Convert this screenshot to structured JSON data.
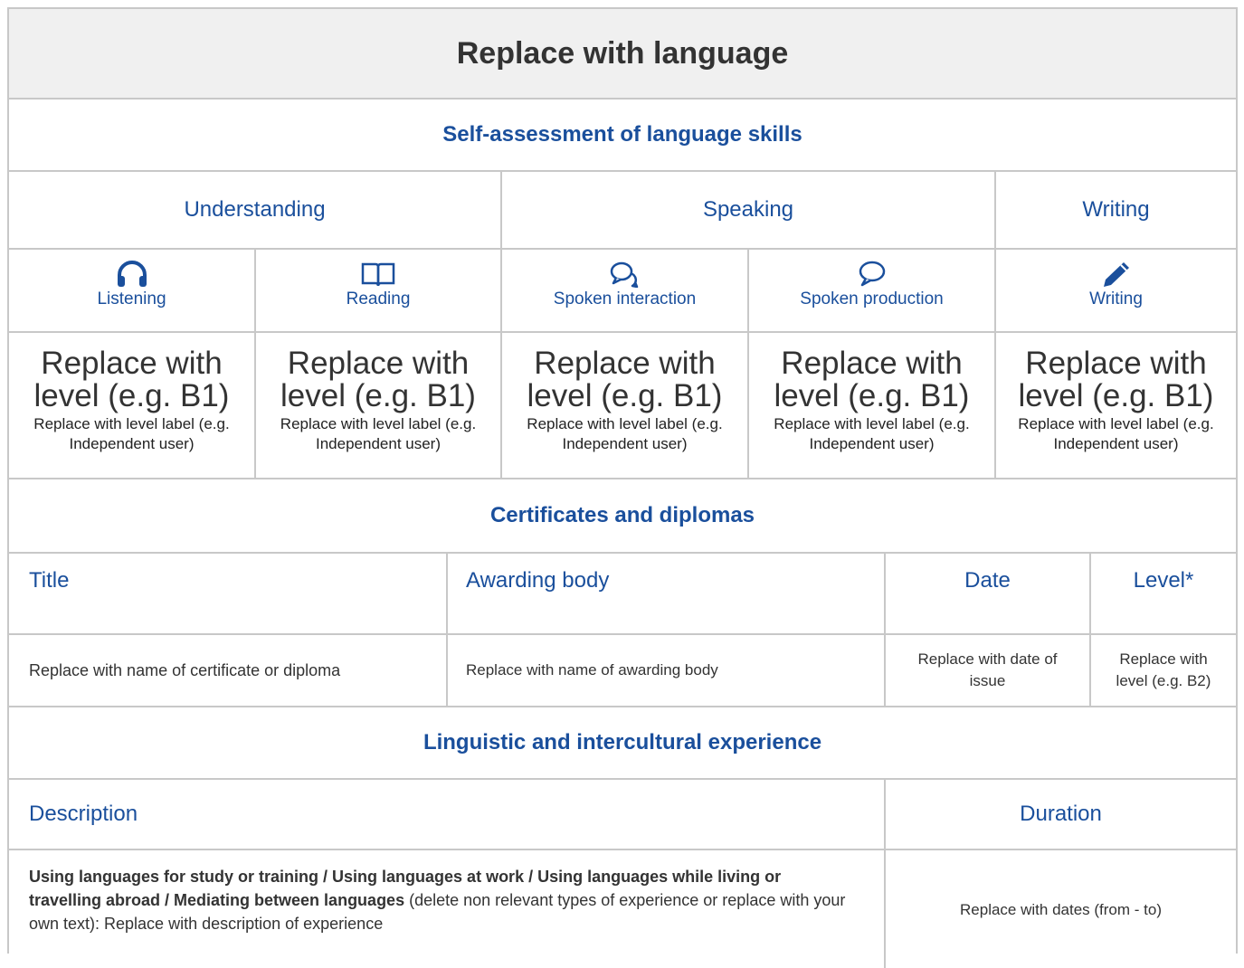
{
  "header": {
    "title": "Replace with language"
  },
  "self_assessment": {
    "heading": "Self-assessment of language skills",
    "groups": {
      "understanding": "Understanding",
      "speaking": "Speaking",
      "writing": "Writing"
    },
    "skills": [
      {
        "label": "Listening",
        "icon": "headphones-icon"
      },
      {
        "label": "Reading",
        "icon": "book-icon"
      },
      {
        "label": "Spoken interaction",
        "icon": "chat-bubbles-icon"
      },
      {
        "label": "Spoken production",
        "icon": "speech-bubble-icon"
      },
      {
        "label": "Writing",
        "icon": "pencil-icon"
      }
    ],
    "levels": [
      {
        "level": "Replace with level (e.g. B1)",
        "label": "Replace with level label (e.g. Independent user)"
      },
      {
        "level": "Replace with level (e.g. B1)",
        "label": "Replace with level label (e.g. Independent user)"
      },
      {
        "level": "Replace with level (e.g. B1)",
        "label": "Replace with level label (e.g. Independent user)"
      },
      {
        "level": "Replace with level (e.g. B1)",
        "label": "Replace with level label (e.g. Independent user)"
      },
      {
        "level": "Replace with level (e.g. B1)",
        "label": "Replace with level label (e.g. Independent user)"
      }
    ]
  },
  "certificates": {
    "heading": "Certificates and diplomas",
    "columns": {
      "title": "Title",
      "awarding_body": "Awarding body",
      "date": "Date",
      "level": "Level*"
    },
    "row": {
      "title": "Replace with name of certificate or diploma",
      "awarding_body": "Replace with name of awarding body",
      "date": "Replace with date of issue",
      "level": "Replace with level (e.g. B2)"
    }
  },
  "experience": {
    "heading": "Linguistic and intercultural experience",
    "columns": {
      "description": "Description",
      "duration": "Duration"
    },
    "row": {
      "types": "Using languages for study or training / Using languages at work / Using languages while living or travelling abroad / Mediating between languages",
      "description_rest": " (delete non relevant types of experience or replace with your own text): Replace with description of experience",
      "duration": "Replace with dates (from - to)"
    }
  },
  "colors": {
    "accent": "#1a4f9c",
    "border": "#c8c8c8",
    "header_bg": "#f0f0f0"
  }
}
